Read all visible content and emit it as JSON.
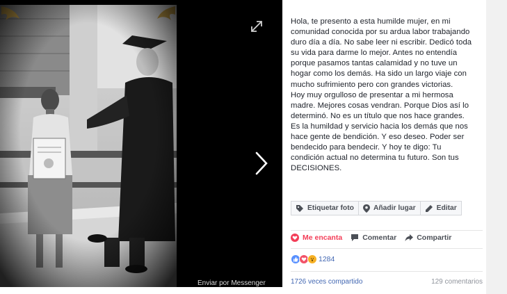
{
  "photo_viewer": {
    "messenger_label": "Enviar por Messenger",
    "expand_icon": "expand-icon",
    "next_icon": "chevron-right-icon"
  },
  "post": {
    "caption_lines": [
      "Hola, te presento a esta humilde mujer, en mi",
      "comunidad conocida por su ardua labor trabajando",
      "duro día a día. No sabe leer ni escribir. Dedicó toda",
      "su vida para darme lo mejor. Antes no entendía",
      "porque pasamos tantas calamidad y no tuve un",
      "hogar como los demás. Ha sido un largo viaje con",
      "mucho sufrimiento pero con grandes victorias.",
      "Hoy muy orgulloso de presentar a mi hermosa",
      "madre. Mejores cosas vendran. Porque Dios así lo",
      "determinó. No es un título que nos hace grandes.",
      "Es la humildad y servicio hacia los demás que nos",
      "hace gente de bendición. Y eso deseo. Poder ser",
      "bendecido para bendecir. Y hoy te digo: Tu",
      "condición actual no determina tu futuro. Son tus",
      "DECISIONES."
    ]
  },
  "photo_actions": {
    "tag_label": "Etiquetar foto",
    "location_label": "Añadir lugar",
    "edit_label": "Editar"
  },
  "post_actions": {
    "like_label": "Me encanta",
    "comment_label": "Comentar",
    "share_label": "Compartir"
  },
  "reactions": {
    "count": "1284",
    "types": [
      "like",
      "love",
      "wow"
    ],
    "colors": {
      "like": "#5890ff",
      "love": "#f25268",
      "wow": "#f7b125"
    }
  },
  "stats": {
    "shares": "1726 veces compartido",
    "comments": "129 comentarios"
  }
}
